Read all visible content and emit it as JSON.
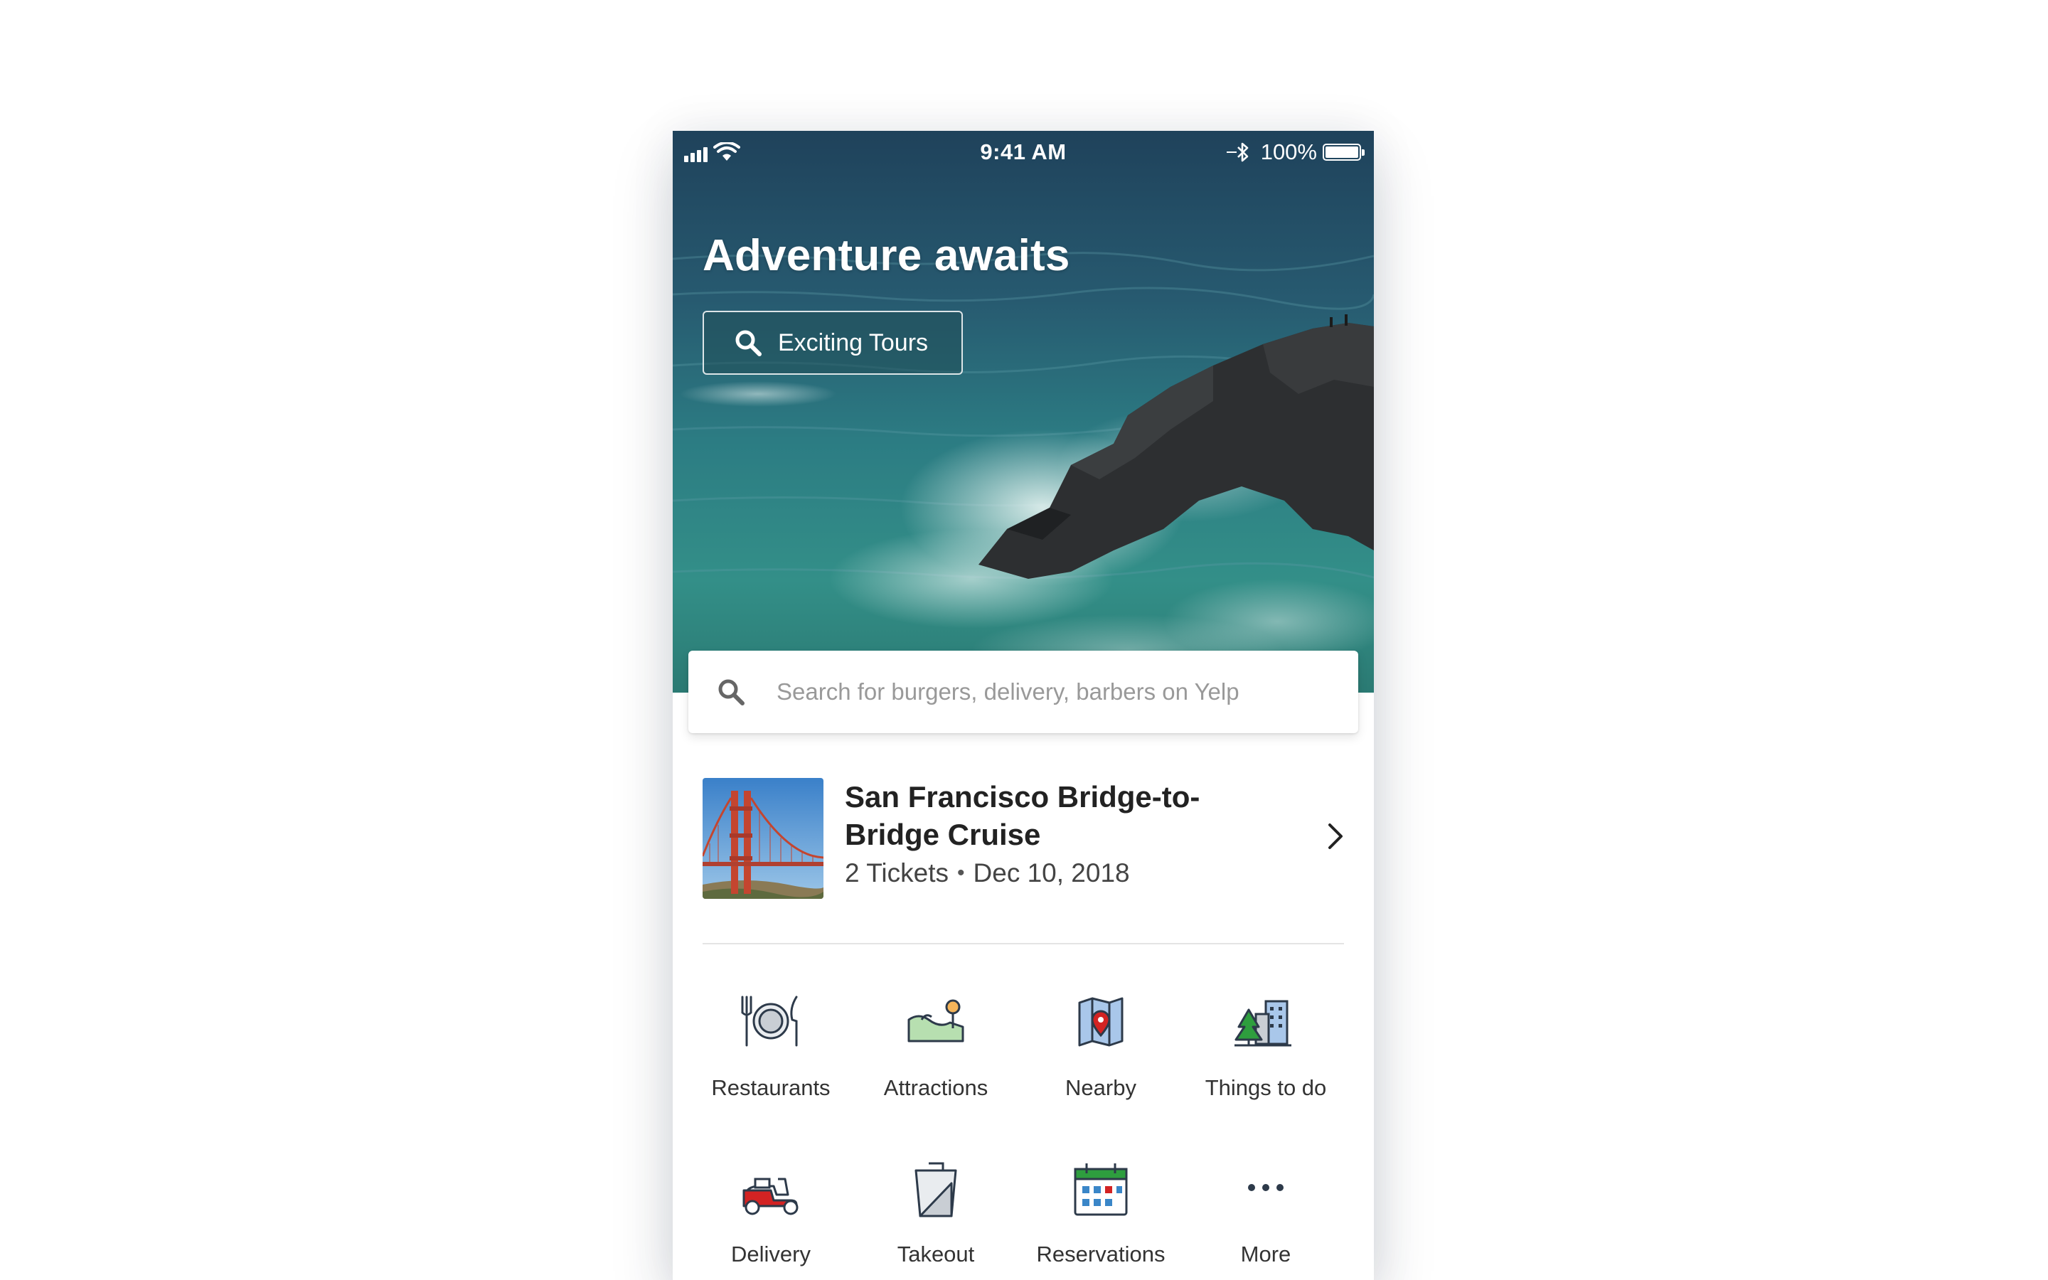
{
  "status_bar": {
    "time": "9:41 AM",
    "battery": "100%"
  },
  "hero": {
    "title": "Adventure awaits",
    "button_label": "Exciting Tours"
  },
  "search": {
    "placeholder": "Search for burgers, delivery, barbers on Yelp"
  },
  "booking": {
    "title": "San Francisco Bridge-to-Bridge Cruise",
    "tickets": "2 Tickets",
    "separator": "•",
    "date": "Dec 10, 2018"
  },
  "categories": [
    {
      "label": "Restaurants",
      "icon": "restaurants-icon"
    },
    {
      "label": "Attractions",
      "icon": "attractions-icon"
    },
    {
      "label": "Nearby",
      "icon": "nearby-icon"
    },
    {
      "label": "Things to do",
      "icon": "things-to-do-icon"
    },
    {
      "label": "Delivery",
      "icon": "delivery-icon"
    },
    {
      "label": "Takeout",
      "icon": "takeout-icon"
    },
    {
      "label": "Reservations",
      "icon": "reservations-icon"
    },
    {
      "label": "More",
      "icon": "more-icon"
    }
  ],
  "colors": {
    "text_primary": "#222222",
    "text_secondary": "#444444",
    "placeholder": "#999999",
    "divider": "#e4e4e4",
    "icon_outline": "#2d3a4a",
    "icon_red": "#d32323",
    "icon_green": "#2e9e3e",
    "icon_blue": "#3a86c8"
  }
}
